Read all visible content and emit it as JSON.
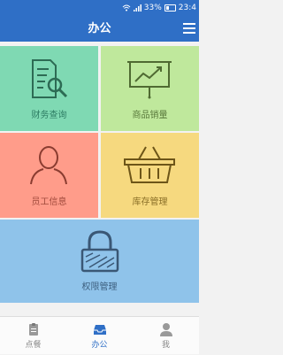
{
  "status_bar": {
    "battery_percent": "33%",
    "time": "23:4"
  },
  "header": {
    "title": "办公",
    "menu_icon": "hamburger-menu-icon"
  },
  "tiles": [
    {
      "label": "财务查询",
      "icon": "document-search-icon",
      "color": "#7fd9b3"
    },
    {
      "label": "商品销量",
      "icon": "sales-chart-board-icon",
      "color": "#bfe89c"
    },
    {
      "label": "员工信息",
      "icon": "person-icon",
      "color": "#ff9c8a"
    },
    {
      "label": "库存管理",
      "icon": "basket-icon",
      "color": "#f6d97f"
    },
    {
      "label": "权限管理",
      "icon": "padlock-icon",
      "color": "#8fc3ea"
    }
  ],
  "tabbar": {
    "tabs": [
      {
        "label": "点餐",
        "icon": "clipboard-icon",
        "active": false
      },
      {
        "label": "办公",
        "icon": "inbox-tray-icon",
        "active": true
      },
      {
        "label": "我",
        "icon": "user-profile-icon",
        "active": false
      }
    ]
  },
  "colors": {
    "header_blue": "#2f6fc6",
    "active_tab": "#2f6fc6",
    "inactive_tab": "#888888"
  }
}
